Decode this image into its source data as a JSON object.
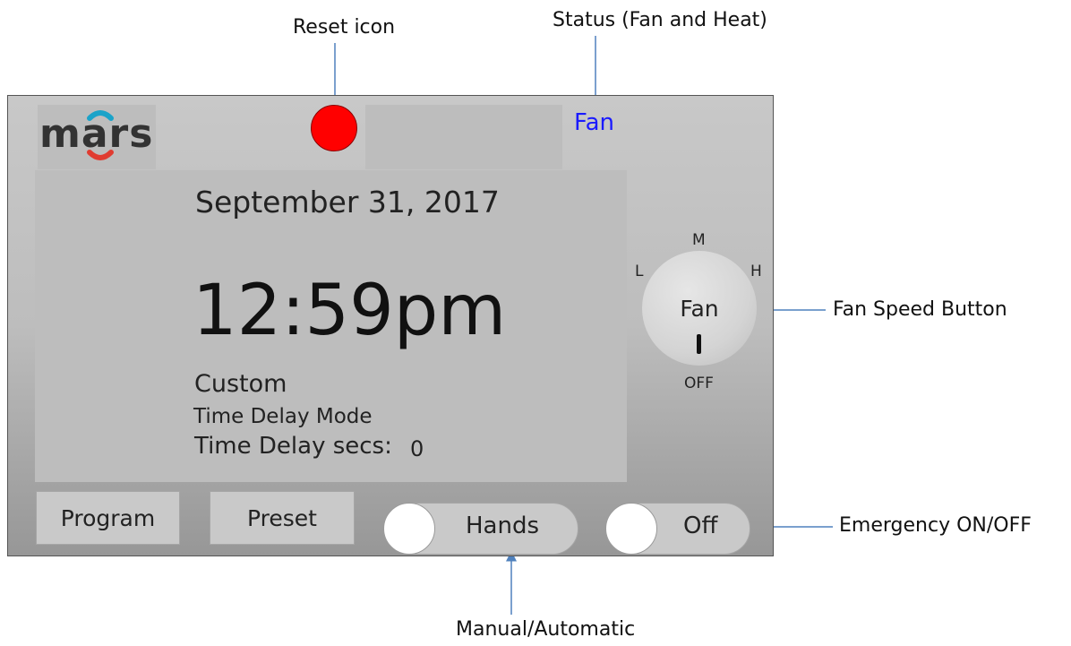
{
  "callouts": {
    "reset": "Reset icon",
    "status": "Status (Fan and Heat)",
    "fan_speed": "Fan Speed Button",
    "emergency": "Emergency ON/OFF",
    "manual_auto": "Manual/Automatic"
  },
  "device": {
    "logo": "mars",
    "status": "Fan",
    "date": "September 31, 2017",
    "time": "12:59pm",
    "mode": "Custom",
    "submode": "Time Delay Mode",
    "delay_label": "Time Delay secs:",
    "delay_value": "0",
    "fan_dial": {
      "label": "Fan",
      "positions": {
        "low": "L",
        "medium": "M",
        "high": "H",
        "off": "OFF"
      }
    },
    "buttons": {
      "program": "Program",
      "preset": "Preset"
    },
    "toggles": {
      "mode": "Hands",
      "emergency": "Off"
    }
  },
  "colors": {
    "reset": "#ff0000",
    "status_text": "#1a1aff",
    "arrow": "#4f81bd",
    "logo_top_arc": "#1aa3c9",
    "logo_bottom_arc": "#e03c31"
  }
}
